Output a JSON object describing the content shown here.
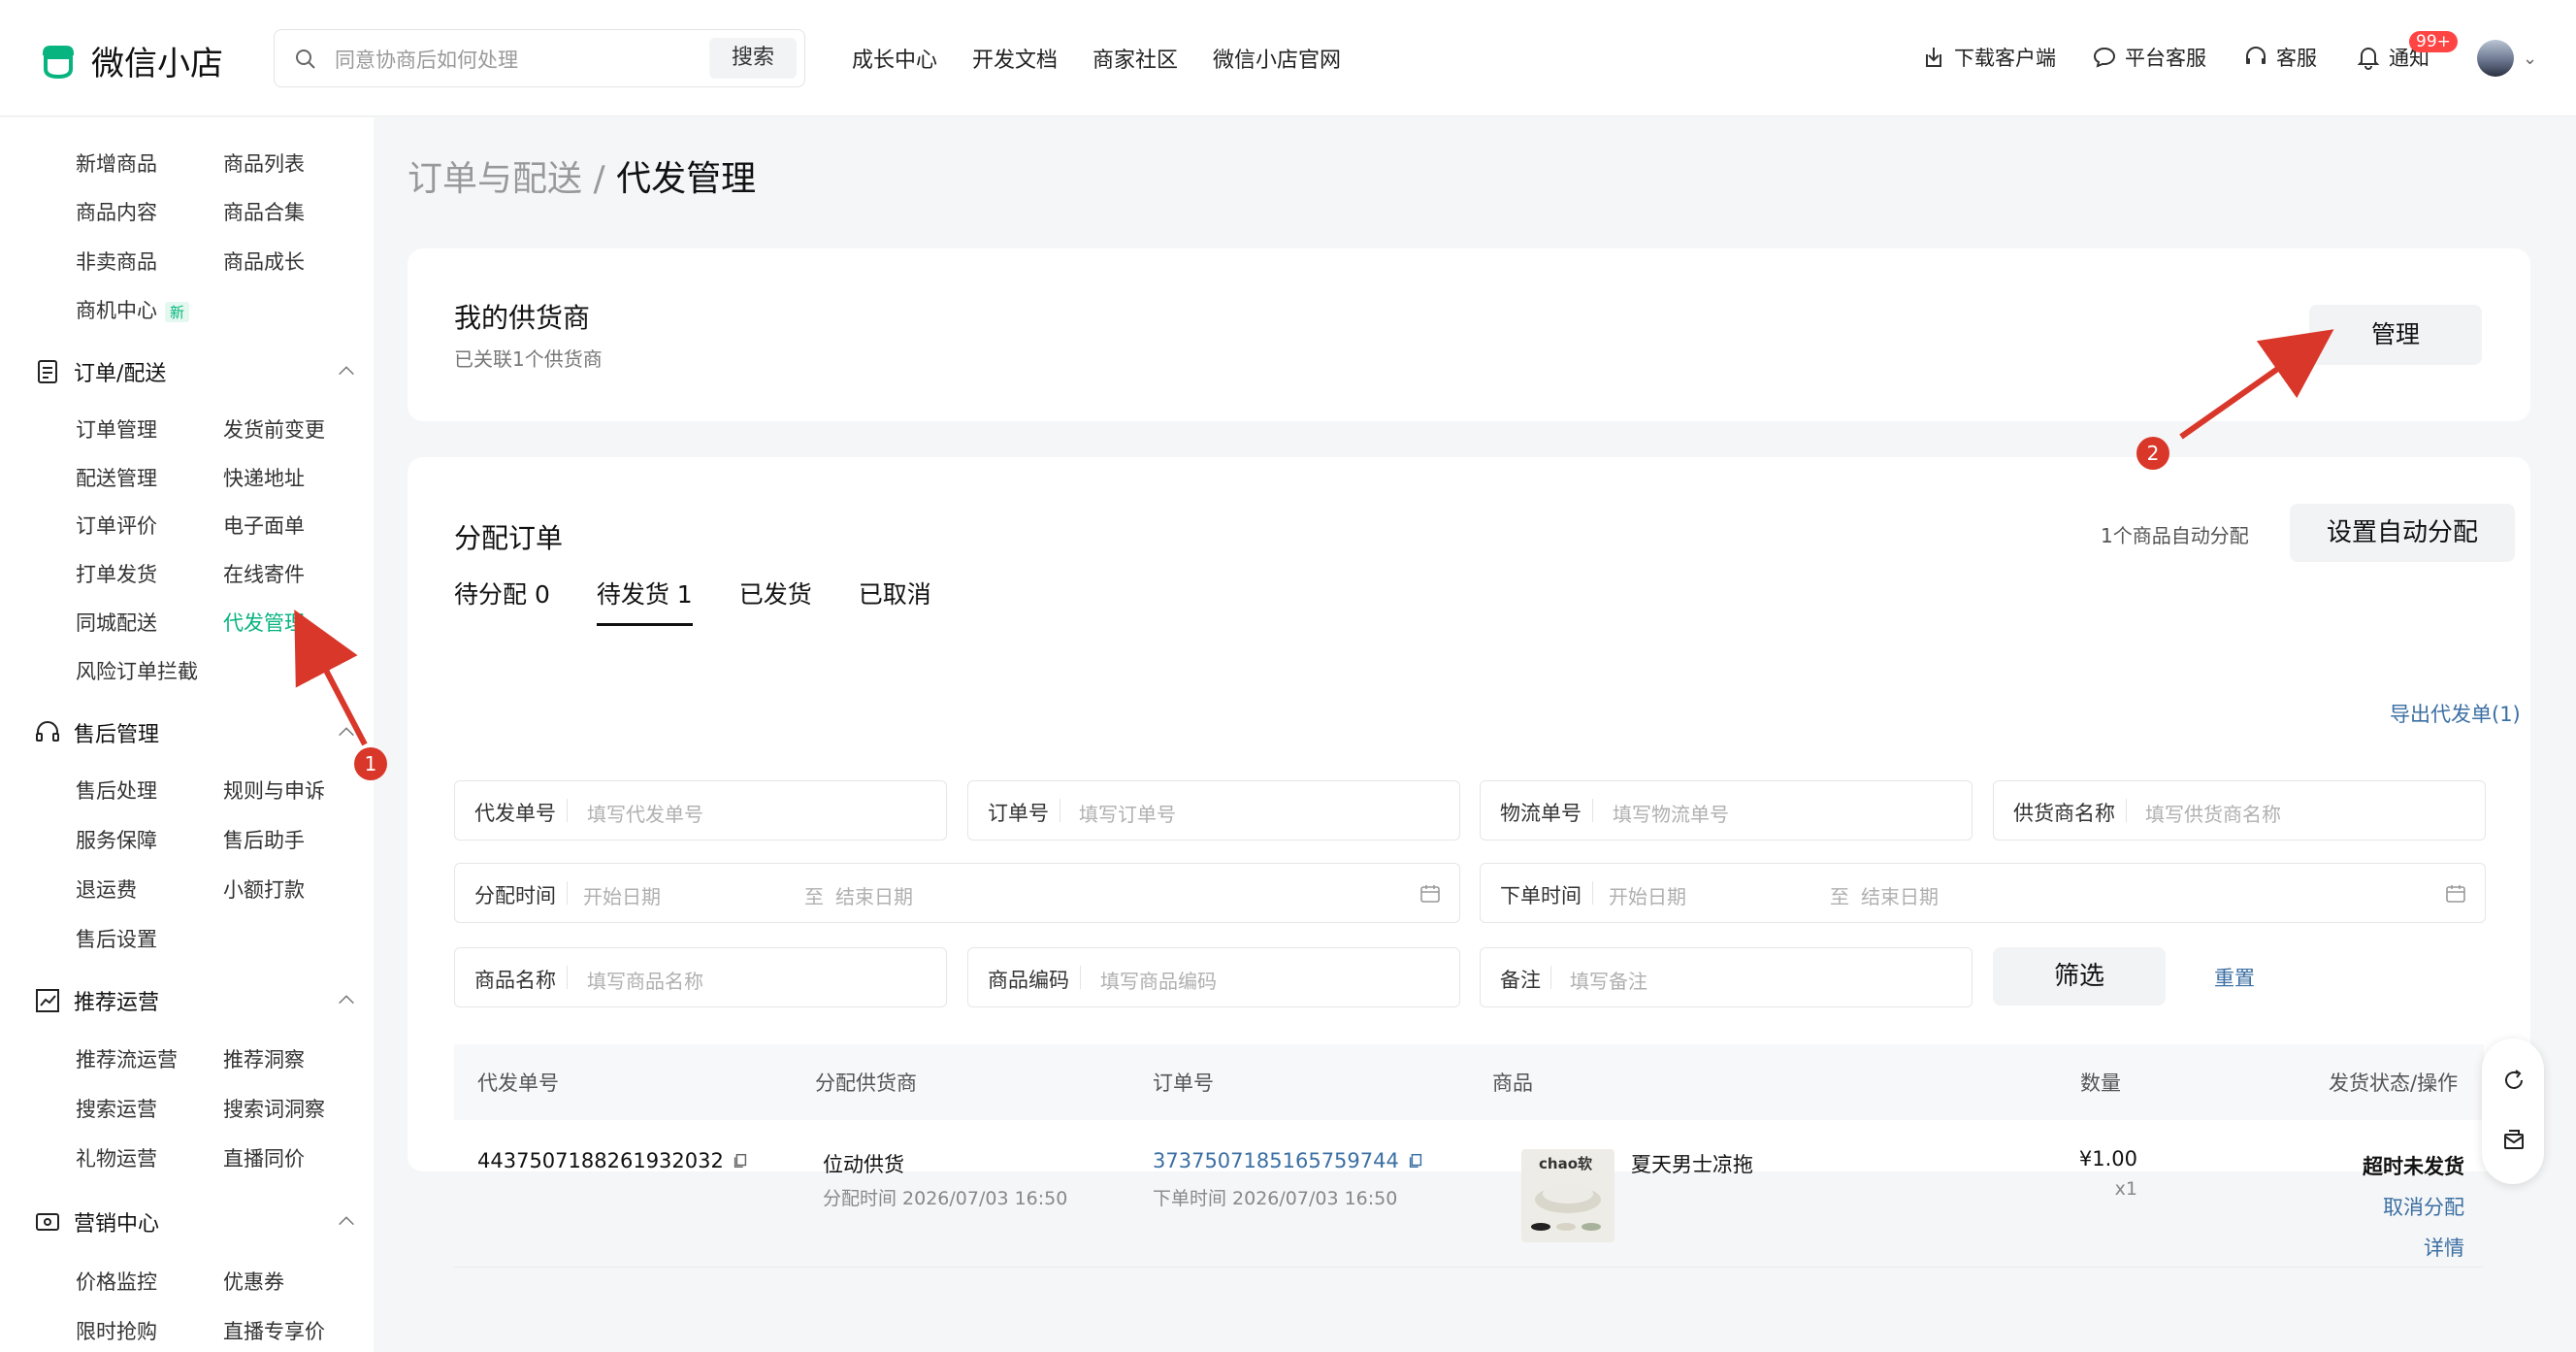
{
  "app": {
    "name": "微信小店"
  },
  "search": {
    "placeholder": "同意协商后如何处理",
    "button": "搜索"
  },
  "topnav": [
    "成长中心",
    "开发文档",
    "商家社区",
    "微信小店官网"
  ],
  "topright": {
    "download": "下载客户端",
    "platform_service": "平台客服",
    "service": "客服",
    "notify": "通知",
    "notify_badge": "99+"
  },
  "sidebar": {
    "goods_items": [
      "新增商品",
      "商品列表",
      "商品内容",
      "商品合集",
      "非卖商品",
      "商品成长",
      "商机中心"
    ],
    "new_badge": "新",
    "order_section": "订单/配送",
    "order_items": [
      "订单管理",
      "发货前变更",
      "配送管理",
      "快递地址",
      "订单评价",
      "电子面单",
      "打单发货",
      "在线寄件",
      "同城配送",
      "代发管理",
      "风险订单拦截"
    ],
    "aftersale_section": "售后管理",
    "aftersale_items": [
      "售后处理",
      "规则与申诉",
      "服务保障",
      "售后助手",
      "退运费",
      "小额打款",
      "售后设置"
    ],
    "recommend_section": "推荐运营",
    "recommend_items": [
      "推荐流运营",
      "推荐洞察",
      "搜索运营",
      "搜索词洞察",
      "礼物运营",
      "直播同价"
    ],
    "marketing_section": "营销中心",
    "marketing_items": [
      "价格监控",
      "优惠券",
      "限时抢购",
      "直播专享价"
    ]
  },
  "breadcrumb": {
    "parent": "订单与配送",
    "sep": "/",
    "current": "代发管理"
  },
  "supplier_card": {
    "title": "我的供货商",
    "subtitle": "已关联1个供货商",
    "manage_button": "管理"
  },
  "assign_card": {
    "title": "分配订单",
    "auto_note": "1个商品自动分配",
    "auto_button": "设置自动分配",
    "tabs": [
      "待分配 0",
      "待发货 1",
      "已发货",
      "已取消"
    ],
    "active_tab": 1,
    "export_link": "导出代发单(1)",
    "filters": {
      "dropship_no": {
        "label": "代发单号",
        "placeholder": "填写代发单号"
      },
      "order_no": {
        "label": "订单号",
        "placeholder": "填写订单号"
      },
      "logistics_no": {
        "label": "物流单号",
        "placeholder": "填写物流单号"
      },
      "supplier_name": {
        "label": "供货商名称",
        "placeholder": "填写供货商名称"
      },
      "assign_time": {
        "label": "分配时间",
        "start": "开始日期",
        "to": "至",
        "end": "结束日期"
      },
      "order_time": {
        "label": "下单时间",
        "start": "开始日期",
        "to": "至",
        "end": "结束日期"
      },
      "product_name": {
        "label": "商品名称",
        "placeholder": "填写商品名称"
      },
      "product_code": {
        "label": "商品编码",
        "placeholder": "填写商品编码"
      },
      "remark": {
        "label": "备注",
        "placeholder": "填写备注"
      },
      "filter_button": "筛选",
      "reset_link": "重置"
    },
    "table": {
      "headers": [
        "代发单号",
        "分配供货商",
        "订单号",
        "商品",
        "数量",
        "发货状态/操作"
      ],
      "rows": [
        {
          "dropship_no": "4437507188261932032",
          "supplier": "位动供货",
          "assign_time": "分配时间 2026/07/03 16:50",
          "order_no": "3737507185165759744",
          "order_time": "下单时间 2026/07/03 16:50",
          "product_name": "夏天男士凉拖",
          "thumb_text": "chao软",
          "price": "¥1.00",
          "qty": "x1",
          "status": "超时未发货",
          "cancel": "取消分配",
          "detail": "详情"
        }
      ]
    }
  },
  "markers": [
    "1",
    "2"
  ],
  "colors": {
    "accent_green": "#07b47f",
    "link_blue": "#3c6fa3",
    "marker_red": "#d9372a"
  }
}
